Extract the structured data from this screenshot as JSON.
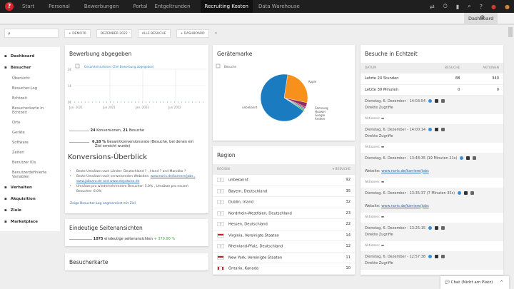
{
  "topnav": {
    "items": [
      "Start",
      "Personal",
      "Bewerbungen",
      "Portal",
      "Entgeltrunden",
      "Recruiting Kosten",
      "Data Warehouse"
    ],
    "active": "Recruiting Kosten"
  },
  "subbar": {
    "tab": "Dashboard"
  },
  "toolbar": {
    "buttons": [
      "+ DEMO70",
      "DEZEMBER 2022",
      "ALLE BESUCHE",
      "+ DASHBOARD"
    ]
  },
  "sidebar": {
    "sections": [
      {
        "label": "Dashboard",
        "icon": "grid-icon"
      },
      {
        "label": "Besucher",
        "icon": "user-icon",
        "items": [
          "Übersicht",
          "Besucher-Log",
          "Echtzeit",
          "Besucherkarte in Echtzeit",
          "Orte",
          "Geräte",
          "Software",
          "Zeiten",
          "Benutzer IDs",
          "Benutzerdefinierte Variablen"
        ]
      },
      {
        "label": "Verhalten",
        "icon": "bell-icon"
      },
      {
        "label": "Akquisition",
        "icon": "box-icon"
      },
      {
        "label": "Ziele",
        "icon": "target-icon"
      },
      {
        "label": "Marketplace",
        "icon": "bag-icon"
      }
    ]
  },
  "bewerbung": {
    "title": "Bewerbung abgegeben",
    "legend": "Gesamteinnahmen (Ziel Bewerbung abgegeben)",
    "yticks": [
      "2€",
      "1€",
      "0€"
    ],
    "xticks": [
      "Jan. 2021",
      "Jun 2021",
      "Jan. 2022",
      "Jun 2022"
    ],
    "conv_num": "24",
    "conv_label": "Konversionen,",
    "visits_num": "21",
    "visits_label": "Besuche",
    "rate": "6,18 %",
    "rate_label": "Gesamtkonversionsrate (Besuche, bei denen ein Ziel erreicht wurde)"
  },
  "overview": {
    "title": "Konversions-Überblick",
    "line1": "Beste Umsätze nach Länder: Deutschland ? , Irland ? and Marokko ?",
    "line2_pre": "Beste Umsätze nach verweisenden Websites: ",
    "line2_links": "www.noris.de/karriere/jobs , www.jobsara.de and www.stepstone.de",
    "line3": "Umsätze pro wiederkehrendem Besucher: 5.0% , Umsätze pro neuem Besucher: 6.0%",
    "link": "Zeige Besucher-Log segmentiert mit Ziel"
  },
  "unique": {
    "title": "Eindeutige Seitenansichten",
    "value": "1075",
    "label": "eindeutige seitenansichten",
    "change": "+ 379.90 %"
  },
  "map": {
    "title": "Besucherkarte"
  },
  "chart_data": {
    "type": "pie",
    "title": "Gerätemarke",
    "legend": "Besuche",
    "categories": [
      "unbekannt",
      "Apple",
      "Samsung",
      "Huawei",
      "Google",
      "Andere"
    ],
    "values": [
      68,
      26,
      3,
      1,
      1,
      1
    ],
    "colors": [
      "#1a7bc0",
      "#f8901c",
      "#8b2d6a",
      "#c0275a",
      "#3aa8c0",
      "#6bb04a"
    ]
  },
  "region": {
    "title": "Region",
    "col1": "REGION",
    "col2": "▾ BESUCHE",
    "rows": [
      {
        "flag": "?",
        "name": "unbekannt",
        "v": "92"
      },
      {
        "flag": "?",
        "name": "Bayern, Deutschland",
        "v": "35"
      },
      {
        "flag": "?",
        "name": "Dublin, Irland",
        "v": "32"
      },
      {
        "flag": "?",
        "name": "Nordrhein-Westfalen, Deutschland",
        "v": "23"
      },
      {
        "flag": "?",
        "name": "Hessen, Deutschland",
        "v": "22"
      },
      {
        "flag": "us",
        "name": "Virginia, Vereinigte Staaten",
        "v": "14"
      },
      {
        "flag": "?",
        "name": "Rheinland-Pfalz, Deutschland",
        "v": "12"
      },
      {
        "flag": "us",
        "name": "New York, Vereinigte Staaten",
        "v": "11"
      },
      {
        "flag": "ca",
        "name": "Ontario, Kanada",
        "v": "10"
      }
    ]
  },
  "realtime": {
    "title": "Besuche in Echtzeit",
    "cols": [
      "DATUM",
      "BESUCHE",
      "AKTIONEN"
    ],
    "rows": [
      [
        "Letzte 24 Stunden",
        "88",
        "340"
      ],
      [
        "Letzte 30 Minuten",
        "0",
        "0"
      ]
    ],
    "visits": [
      {
        "time": "Dienstag, 6. Dezember - 14:03:54",
        "src": "Direkte Zugriffe",
        "actions": "Aktionen:"
      },
      {
        "time": "Dienstag, 6. Dezember - 14:00:14",
        "src": "Direkte Zugriffe",
        "actions": "Aktionen:"
      },
      {
        "time": "Dienstag, 6. Dezember - 13:48:35 (19 Minuten 21s)",
        "src": "Website: ",
        "link": "www.noris.de/karriere/jobs",
        "actions": "Aktionen:"
      },
      {
        "time": "Dienstag, 6. Dezember - 13:35:37 (7 Minuten 35s)",
        "src": "Website: ",
        "link": "www.noris.de/karriere/jobs",
        "actions": "Aktionen:"
      },
      {
        "time": "Dienstag, 6. Dezember - 13:25:15",
        "src": "Direkte Zugriffe",
        "actions": "Aktionen:"
      },
      {
        "time": "Dienstag, 6. Dezember - 12:57:38",
        "src": "Direkte Zugriffe",
        "actions": ""
      }
    ]
  },
  "chat": {
    "label": "Chat (Nicht am Platz)"
  }
}
